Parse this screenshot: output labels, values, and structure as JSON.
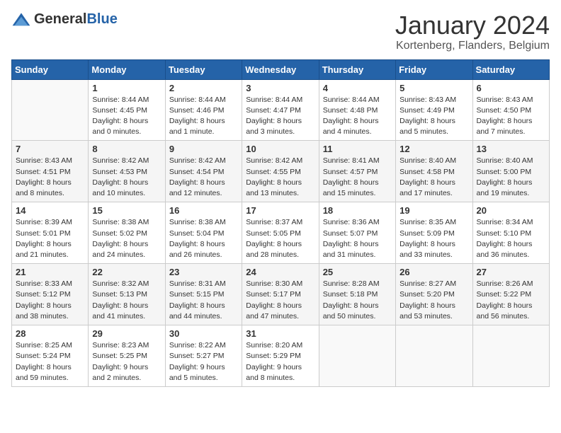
{
  "logo": {
    "general": "General",
    "blue": "Blue"
  },
  "title": "January 2024",
  "location": "Kortenberg, Flanders, Belgium",
  "days_header": [
    "Sunday",
    "Monday",
    "Tuesday",
    "Wednesday",
    "Thursday",
    "Friday",
    "Saturday"
  ],
  "weeks": [
    [
      {
        "day": "",
        "info": ""
      },
      {
        "day": "1",
        "info": "Sunrise: 8:44 AM\nSunset: 4:45 PM\nDaylight: 8 hours\nand 0 minutes."
      },
      {
        "day": "2",
        "info": "Sunrise: 8:44 AM\nSunset: 4:46 PM\nDaylight: 8 hours\nand 1 minute."
      },
      {
        "day": "3",
        "info": "Sunrise: 8:44 AM\nSunset: 4:47 PM\nDaylight: 8 hours\nand 3 minutes."
      },
      {
        "day": "4",
        "info": "Sunrise: 8:44 AM\nSunset: 4:48 PM\nDaylight: 8 hours\nand 4 minutes."
      },
      {
        "day": "5",
        "info": "Sunrise: 8:43 AM\nSunset: 4:49 PM\nDaylight: 8 hours\nand 5 minutes."
      },
      {
        "day": "6",
        "info": "Sunrise: 8:43 AM\nSunset: 4:50 PM\nDaylight: 8 hours\nand 7 minutes."
      }
    ],
    [
      {
        "day": "7",
        "info": "Sunrise: 8:43 AM\nSunset: 4:51 PM\nDaylight: 8 hours\nand 8 minutes."
      },
      {
        "day": "8",
        "info": "Sunrise: 8:42 AM\nSunset: 4:53 PM\nDaylight: 8 hours\nand 10 minutes."
      },
      {
        "day": "9",
        "info": "Sunrise: 8:42 AM\nSunset: 4:54 PM\nDaylight: 8 hours\nand 12 minutes."
      },
      {
        "day": "10",
        "info": "Sunrise: 8:42 AM\nSunset: 4:55 PM\nDaylight: 8 hours\nand 13 minutes."
      },
      {
        "day": "11",
        "info": "Sunrise: 8:41 AM\nSunset: 4:57 PM\nDaylight: 8 hours\nand 15 minutes."
      },
      {
        "day": "12",
        "info": "Sunrise: 8:40 AM\nSunset: 4:58 PM\nDaylight: 8 hours\nand 17 minutes."
      },
      {
        "day": "13",
        "info": "Sunrise: 8:40 AM\nSunset: 5:00 PM\nDaylight: 8 hours\nand 19 minutes."
      }
    ],
    [
      {
        "day": "14",
        "info": "Sunrise: 8:39 AM\nSunset: 5:01 PM\nDaylight: 8 hours\nand 21 minutes."
      },
      {
        "day": "15",
        "info": "Sunrise: 8:38 AM\nSunset: 5:02 PM\nDaylight: 8 hours\nand 24 minutes."
      },
      {
        "day": "16",
        "info": "Sunrise: 8:38 AM\nSunset: 5:04 PM\nDaylight: 8 hours\nand 26 minutes."
      },
      {
        "day": "17",
        "info": "Sunrise: 8:37 AM\nSunset: 5:05 PM\nDaylight: 8 hours\nand 28 minutes."
      },
      {
        "day": "18",
        "info": "Sunrise: 8:36 AM\nSunset: 5:07 PM\nDaylight: 8 hours\nand 31 minutes."
      },
      {
        "day": "19",
        "info": "Sunrise: 8:35 AM\nSunset: 5:09 PM\nDaylight: 8 hours\nand 33 minutes."
      },
      {
        "day": "20",
        "info": "Sunrise: 8:34 AM\nSunset: 5:10 PM\nDaylight: 8 hours\nand 36 minutes."
      }
    ],
    [
      {
        "day": "21",
        "info": "Sunrise: 8:33 AM\nSunset: 5:12 PM\nDaylight: 8 hours\nand 38 minutes."
      },
      {
        "day": "22",
        "info": "Sunrise: 8:32 AM\nSunset: 5:13 PM\nDaylight: 8 hours\nand 41 minutes."
      },
      {
        "day": "23",
        "info": "Sunrise: 8:31 AM\nSunset: 5:15 PM\nDaylight: 8 hours\nand 44 minutes."
      },
      {
        "day": "24",
        "info": "Sunrise: 8:30 AM\nSunset: 5:17 PM\nDaylight: 8 hours\nand 47 minutes."
      },
      {
        "day": "25",
        "info": "Sunrise: 8:28 AM\nSunset: 5:18 PM\nDaylight: 8 hours\nand 50 minutes."
      },
      {
        "day": "26",
        "info": "Sunrise: 8:27 AM\nSunset: 5:20 PM\nDaylight: 8 hours\nand 53 minutes."
      },
      {
        "day": "27",
        "info": "Sunrise: 8:26 AM\nSunset: 5:22 PM\nDaylight: 8 hours\nand 56 minutes."
      }
    ],
    [
      {
        "day": "28",
        "info": "Sunrise: 8:25 AM\nSunset: 5:24 PM\nDaylight: 8 hours\nand 59 minutes."
      },
      {
        "day": "29",
        "info": "Sunrise: 8:23 AM\nSunset: 5:25 PM\nDaylight: 9 hours\nand 2 minutes."
      },
      {
        "day": "30",
        "info": "Sunrise: 8:22 AM\nSunset: 5:27 PM\nDaylight: 9 hours\nand 5 minutes."
      },
      {
        "day": "31",
        "info": "Sunrise: 8:20 AM\nSunset: 5:29 PM\nDaylight: 9 hours\nand 8 minutes."
      },
      {
        "day": "",
        "info": ""
      },
      {
        "day": "",
        "info": ""
      },
      {
        "day": "",
        "info": ""
      }
    ]
  ]
}
